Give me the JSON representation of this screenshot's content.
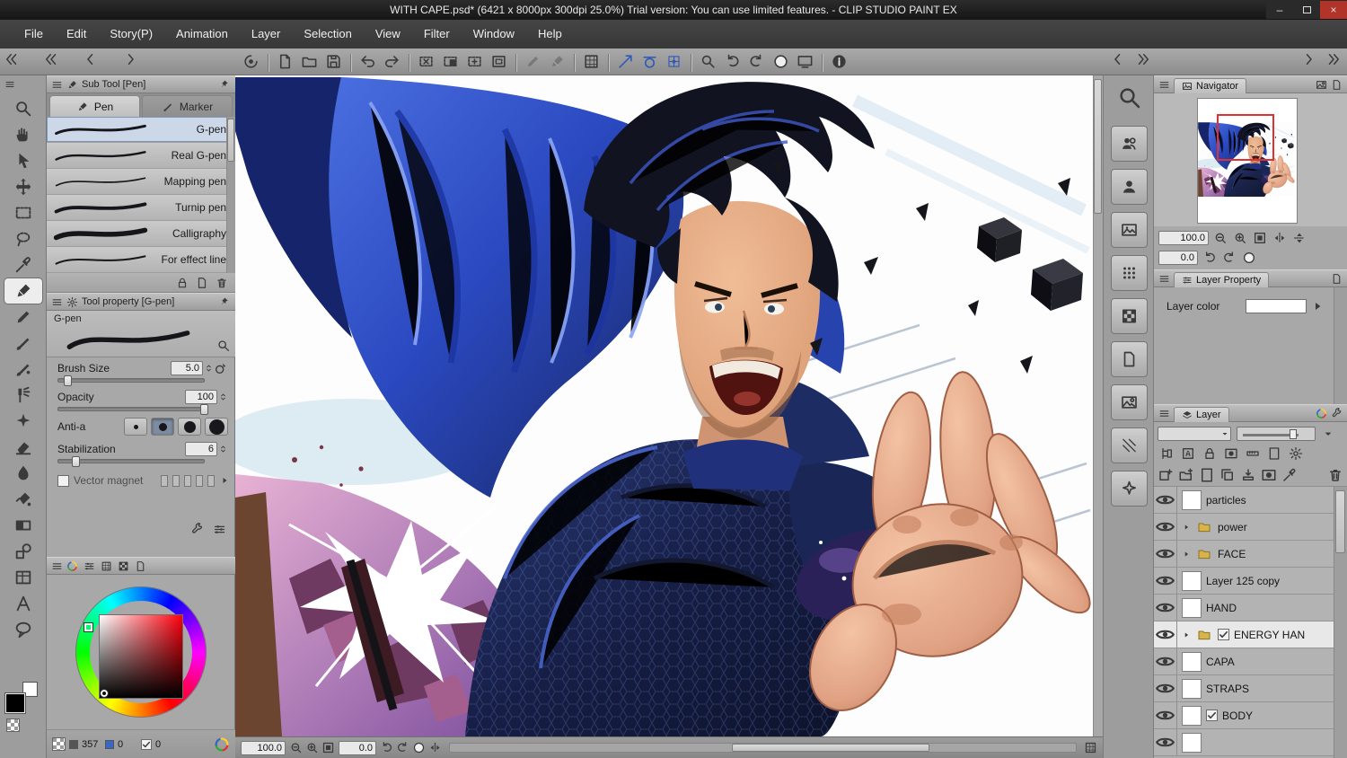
{
  "titlebar": {
    "title": "WITH CAPE.psd* (6421 x 8000px 300dpi 25.0%) Trial version: You can use limited features. - CLIP STUDIO PAINT EX",
    "window_controls": [
      "minimize",
      "maximize",
      "close"
    ]
  },
  "menubar": {
    "items": [
      "File",
      "Edit",
      "Story(P)",
      "Animation",
      "Layer",
      "Selection",
      "View",
      "Filter",
      "Window",
      "Help"
    ]
  },
  "toolbar": {
    "left_collapse": [
      "chevrons-left",
      "chevrons-left",
      "chevron-left",
      "chevron-right"
    ],
    "groups": [
      [
        "clip-studio-logo"
      ],
      [
        "new-canvas",
        "open-file",
        "save-file"
      ],
      [
        "undo",
        "redo"
      ],
      [
        "deselect",
        "invert-selection",
        "select-launch",
        "select-border"
      ],
      [
        "pencil-disabled",
        "pen-disabled"
      ],
      [
        "grid"
      ],
      [
        "snap-to-ruler",
        "snap-to-special-ruler",
        "snap-to-grid"
      ],
      [
        "zoom",
        "rotate-left",
        "rotate-right",
        "reset-display",
        "fit-to-screen"
      ],
      [
        "info"
      ]
    ],
    "right_collapse": [
      "chevron-left",
      "chevrons-right"
    ],
    "far_collapse": [
      "chevron-right",
      "chevrons-right"
    ]
  },
  "toolstrip": {
    "tools": [
      "zoom",
      "hand",
      "operation",
      "move",
      "marquee",
      "lasso",
      "eyedropper",
      "pen",
      "pencil",
      "brush",
      "watercolor",
      "airbrush",
      "decoration",
      "eraser",
      "blend",
      "fill",
      "gradient",
      "figure",
      "frame",
      "text",
      "balloon"
    ],
    "selected": "pen",
    "main_color": "#000000",
    "sub_color": "#ffffff"
  },
  "subtool": {
    "title": "Sub Tool [Pen]",
    "tabs": [
      {
        "label": "Pen",
        "active": true
      },
      {
        "label": "Marker",
        "active": false
      }
    ],
    "items": [
      {
        "name": "G-pen",
        "stroke": 3.2,
        "selected": true
      },
      {
        "name": "Real G-pen",
        "stroke": 2.6,
        "selected": false
      },
      {
        "name": "Mapping pen",
        "stroke": 1.8,
        "selected": false
      },
      {
        "name": "Turnip pen",
        "stroke": 4.2,
        "selected": false
      },
      {
        "name": "Calligraphy",
        "stroke": 6,
        "selected": false
      },
      {
        "name": "For effect line",
        "stroke": 2.2,
        "selected": false
      }
    ],
    "footer_icons": [
      "lock",
      "page",
      "trash"
    ]
  },
  "tool_property": {
    "title": "Tool property [G-pen]",
    "preview_label": "G-pen",
    "params": [
      {
        "type": "slider",
        "label": "Brush Size",
        "value": "5.0",
        "percent": 6,
        "extra_icon": "brush-size-picker"
      },
      {
        "type": "slider",
        "label": "Opacity",
        "value": "100",
        "percent": 100
      },
      {
        "type": "antialias",
        "label": "Anti-a",
        "options": 4,
        "selected": 1
      },
      {
        "type": "slider",
        "label": "Stabilization",
        "value": "6",
        "percent": 12
      }
    ],
    "vector_magnet": {
      "label": "Vector magnet",
      "checked": false
    }
  },
  "color_panel": {
    "header_icons": [
      "color-wheel",
      "sliders",
      "grid",
      "checker",
      "page"
    ],
    "hue": 357,
    "readouts": [
      {
        "icon": "swatch",
        "value": "357"
      },
      {
        "icon": "swatch-blue",
        "value": "0"
      },
      {
        "icon": "checkbox",
        "value": "0"
      }
    ]
  },
  "canvas_bar": {
    "zoom": "100.0",
    "rotation": "0.0",
    "zoom_icons": [
      "zoom-out",
      "zoom-in",
      "fit-100"
    ],
    "rotation_icons": [
      "rotate-left",
      "rotate-right",
      "reset-display",
      "flip-h"
    ]
  },
  "materials": {
    "icons": [
      "people",
      "person",
      "photo",
      "halftone",
      "checker",
      "page",
      "landscape",
      "pattern",
      "decor"
    ]
  },
  "navigator": {
    "title": "Navigator",
    "zoom": "100.0",
    "rotation": "0.0",
    "zoom_icons": [
      "zoom-out",
      "zoom-in",
      "fit-100",
      "flip-h",
      "flip-v"
    ],
    "rotation_icons": [
      "rotate-left",
      "rotate-right",
      "reset-display"
    ]
  },
  "layer_property": {
    "title": "Layer Property",
    "layer_color_label": "Layer color"
  },
  "layer_panel": {
    "title": "Layer",
    "toolbar_icons_a": [
      "clip-mask",
      "alpha-lock",
      "lock",
      "mask",
      "ruler-icon",
      "paper",
      "gear"
    ],
    "toolbar_icons_b": [
      "new-layer",
      "new-folder",
      "paper",
      "copy-layer",
      "merge-down",
      "mask",
      "eyedropper",
      "trash"
    ],
    "layers": [
      {
        "name": "particles",
        "type": "layer",
        "visible": true
      },
      {
        "name": "power",
        "type": "folder",
        "visible": true
      },
      {
        "name": "FACE",
        "type": "folder",
        "visible": true
      },
      {
        "name": "Layer 125 copy",
        "type": "layer",
        "visible": true
      },
      {
        "name": "HAND",
        "type": "layer",
        "visible": true
      },
      {
        "name": "ENERGY HAN",
        "type": "folder",
        "checked": true,
        "selected": true,
        "visible": true
      },
      {
        "name": "CAPA",
        "type": "layer",
        "visible": true
      },
      {
        "name": "STRAPS",
        "type": "layer",
        "visible": true
      },
      {
        "name": "BODY",
        "type": "layer",
        "checked": true,
        "visible": true
      },
      {
        "name": "",
        "type": "layer",
        "visible": true
      }
    ]
  }
}
